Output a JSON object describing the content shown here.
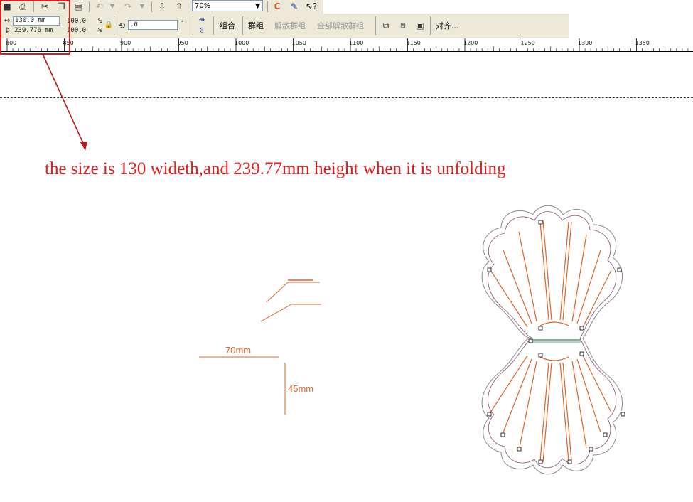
{
  "toolbar": {
    "zoom_value": "70%",
    "width_value": "130.0 mm",
    "height_value": "239.776 mm",
    "scale_x": "100.0",
    "scale_y": "100.0",
    "percent_x": "%",
    "percent_y": "%",
    "rotation_value": ".0",
    "degree_symbol": "°",
    "group_label": "组合",
    "group_items_label": "群组",
    "ungroup_label": "解散群组",
    "ungroup_all_label": "全部解散群组",
    "align_label": "对齐..."
  },
  "ruler": {
    "ticks": [
      "800",
      "850",
      "900",
      "950",
      "1000",
      "1050",
      "1100",
      "1150",
      "1200",
      "1250",
      "1300",
      "1350"
    ]
  },
  "annotation": {
    "note": "the size is 130 wideth,and 239.77mm height when it is unfolding",
    "dim_width": "70mm",
    "dim_height": "45mm"
  },
  "colors": {
    "annotation_red": "#e31b1b",
    "cut_orange": "#e0622a",
    "fold_green": "#2e8b57"
  }
}
